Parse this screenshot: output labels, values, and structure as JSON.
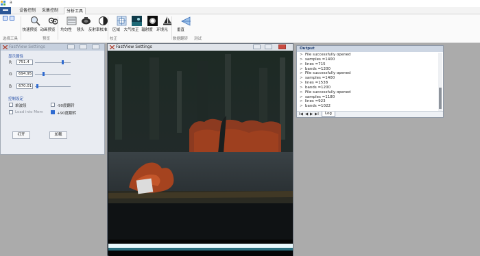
{
  "window": {
    "title": "a"
  },
  "ribbon": {
    "tabs": [
      {
        "label": "设备控制",
        "active": false
      },
      {
        "label": "采集控制",
        "active": false
      },
      {
        "label": "分析工具",
        "active": true
      }
    ],
    "buttons": [
      {
        "id": "quick-preview",
        "label": "快速预览",
        "icon": "magnifier-icon"
      },
      {
        "id": "animated-preview",
        "label": "动画预览",
        "icon": "film-reel-icon"
      },
      {
        "id": "uniformity",
        "label": "均匀性",
        "icon": "grid-lines-icon"
      },
      {
        "id": "lens",
        "label": "镜头",
        "icon": "lens-icon"
      },
      {
        "id": "reflectance",
        "label": "反射率校准",
        "icon": "half-circle-icon"
      },
      {
        "id": "region",
        "label": "区域",
        "icon": "region-icon"
      },
      {
        "id": "atmospheric",
        "label": "大气校正",
        "icon": "atmosphere-icon"
      },
      {
        "id": "radiometric",
        "label": "辐射度",
        "icon": "sun-icon"
      },
      {
        "id": "ambient-light",
        "label": "环境光",
        "icon": "sailboat-icon"
      },
      {
        "id": "vertical",
        "label": "垂直",
        "icon": "vertical-tool-icon"
      }
    ],
    "groups": [
      {
        "label": "选择工具"
      },
      {
        "label": "预览"
      },
      {
        "label": "校正"
      },
      {
        "label": "数据翻转"
      },
      {
        "label": "测试"
      }
    ]
  },
  "settings_window": {
    "title": "FastView Settings",
    "display_section": "显示属性",
    "channels": [
      {
        "label": "R",
        "value": "751.4",
        "level": 0.8
      },
      {
        "label": "G",
        "value": "694.95",
        "level": 0.22
      },
      {
        "label": "B",
        "value": "670.01",
        "level": 0.05
      }
    ],
    "control_section": "控制设定",
    "checkboxes": [
      {
        "label": "单波段",
        "checked": false,
        "dim": false
      },
      {
        "label": "-90度翻转",
        "checked": false,
        "dim": false
      },
      {
        "label": "Load into Mem",
        "checked": false,
        "dim": true
      },
      {
        "label": "+90度翻转",
        "checked": true,
        "dim": false
      }
    ],
    "open_button": "打开",
    "load_button": "加载"
  },
  "viewer_window": {
    "title": "FastView Settings"
  },
  "output_window": {
    "title": "Output",
    "log_prefix": ">",
    "log": [
      "File successfully opened",
      "samples =1400",
      "lines =715",
      "bands =1200",
      "File successfully opened",
      "samples =1400",
      "lines =1538",
      "bands =1200",
      "File successfully opened",
      "samples =1180",
      "lines =923",
      "bands =1022"
    ],
    "tab": "Log",
    "nav": {
      "first": "I◀",
      "prev": "◀",
      "next": "▶",
      "last": "▶I"
    }
  },
  "colors": {
    "accent": "#2f6bd1",
    "ribbon_menu": "#2b5797",
    "desktop": "#ababab",
    "foliage": "#a5431f"
  }
}
